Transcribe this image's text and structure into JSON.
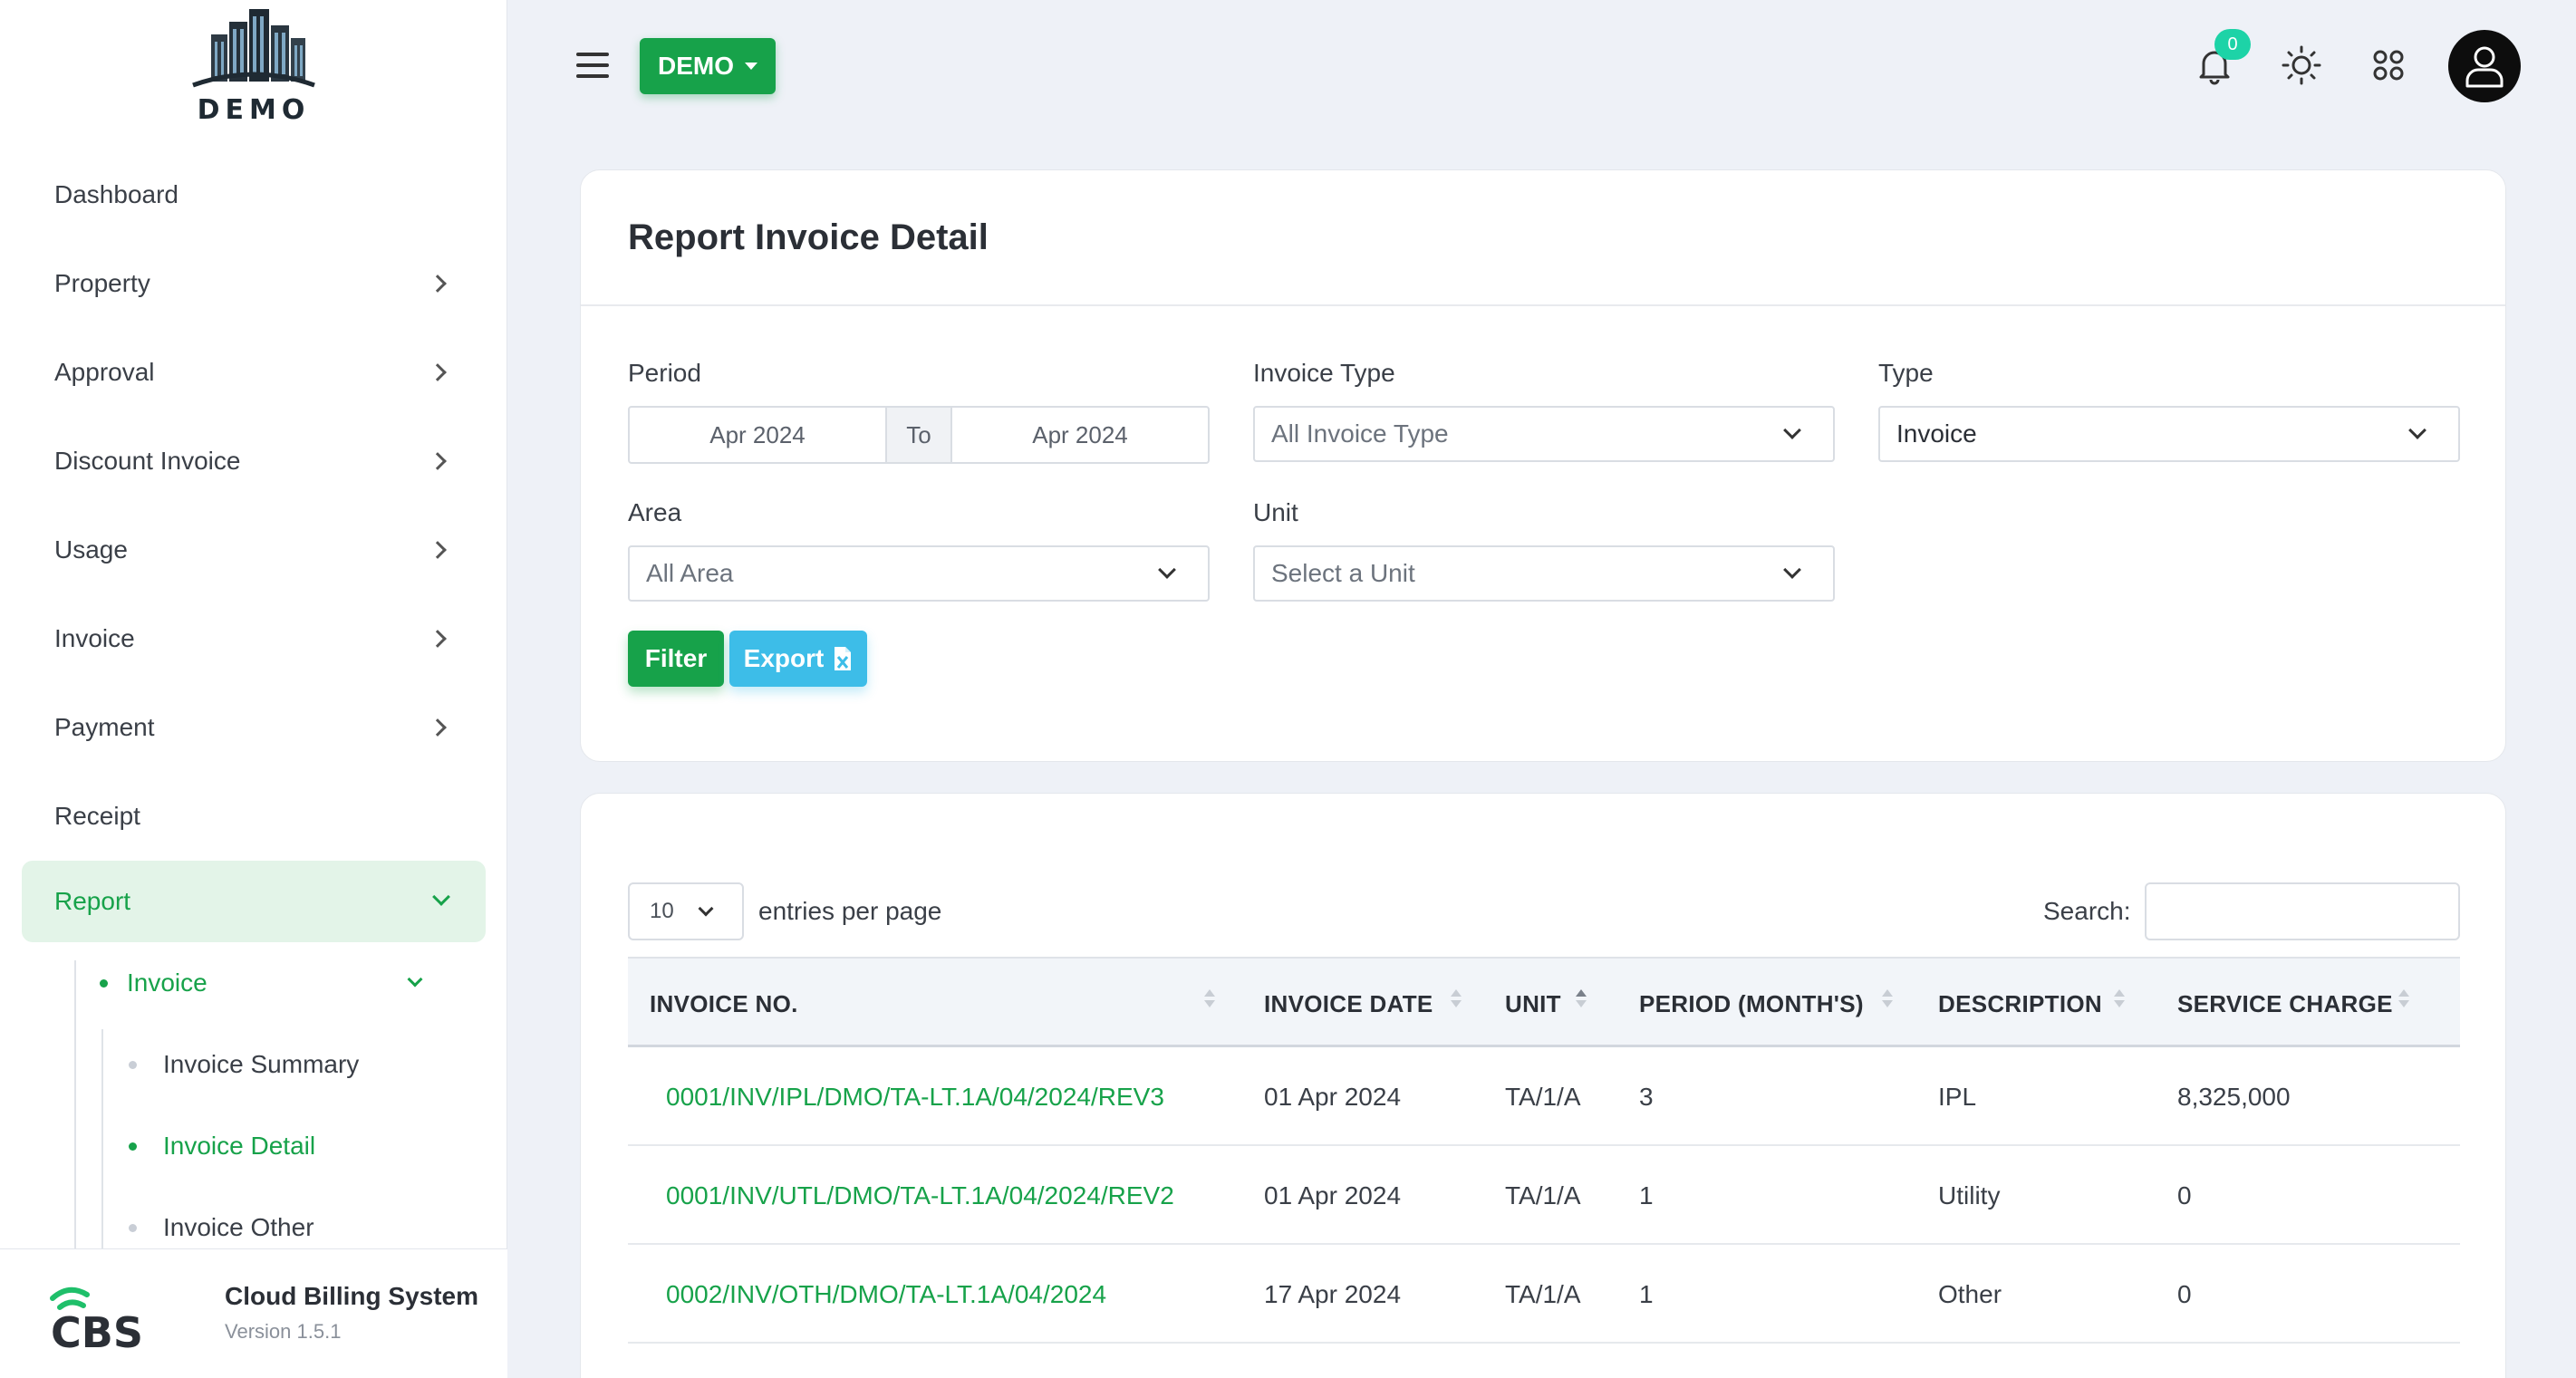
{
  "brand": {
    "logo_text": "DEMO",
    "app_name": "Cloud Billing System",
    "version": "Version 1.5.1"
  },
  "sidebar": {
    "items": [
      {
        "label": "Dashboard"
      },
      {
        "label": "Property"
      },
      {
        "label": "Approval"
      },
      {
        "label": "Discount Invoice"
      },
      {
        "label": "Usage"
      },
      {
        "label": "Invoice"
      },
      {
        "label": "Payment"
      },
      {
        "label": "Receipt"
      },
      {
        "label": "Report"
      }
    ],
    "report_sub": {
      "label": "Invoice"
    },
    "report_invoice_sub": [
      {
        "label": "Invoice Summary"
      },
      {
        "label": "Invoice Detail"
      },
      {
        "label": "Invoice Other"
      }
    ]
  },
  "topbar": {
    "property_label": "DEMO",
    "notification_count": "0"
  },
  "filter_card": {
    "title": "Report Invoice Detail",
    "period": {
      "label": "Period",
      "from": "Apr 2024",
      "to_label": "To",
      "to": "Apr 2024"
    },
    "invoice_type": {
      "label": "Invoice Type",
      "value": "All Invoice Type"
    },
    "type": {
      "label": "Type",
      "value": "Invoice"
    },
    "area": {
      "label": "Area",
      "value": "All Area"
    },
    "unit": {
      "label": "Unit",
      "value": "Select a Unit"
    },
    "filter_label": "Filter",
    "export_label": "Export"
  },
  "table": {
    "entries_value": "10",
    "entries_label": "entries per page",
    "search_label": "Search:",
    "columns": [
      "INVOICE NO.",
      "INVOICE DATE",
      "UNIT",
      "PERIOD (MONTH'S)",
      "DESCRIPTION",
      "SERVICE CHARGE"
    ],
    "rows": [
      {
        "invoice_no": "0001/INV/IPL/DMO/TA-LT.1A/04/2024/REV3",
        "date": "01 Apr 2024",
        "unit": "TA/1/A",
        "period": "3",
        "description": "IPL",
        "service_charge": "8,325,000"
      },
      {
        "invoice_no": "0001/INV/UTL/DMO/TA-LT.1A/04/2024/REV2",
        "date": "01 Apr 2024",
        "unit": "TA/1/A",
        "period": "1",
        "description": "Utility",
        "service_charge": "0"
      },
      {
        "invoice_no": "0002/INV/OTH/DMO/TA-LT.1A/04/2024",
        "date": "17 Apr 2024",
        "unit": "TA/1/A",
        "period": "1",
        "description": "Other",
        "service_charge": "0"
      }
    ]
  },
  "colors": {
    "primary": "#17a24a",
    "info": "#3dbde8",
    "badge": "#1dd3a7",
    "background": "#eef1f7"
  },
  "icons": [
    "menu-icon",
    "caret-down-icon",
    "bell-icon",
    "sun-icon",
    "apps-grid-icon",
    "user-icon",
    "chevron-right-icon",
    "chevron-down-icon",
    "excel-icon",
    "sort-icon"
  ]
}
